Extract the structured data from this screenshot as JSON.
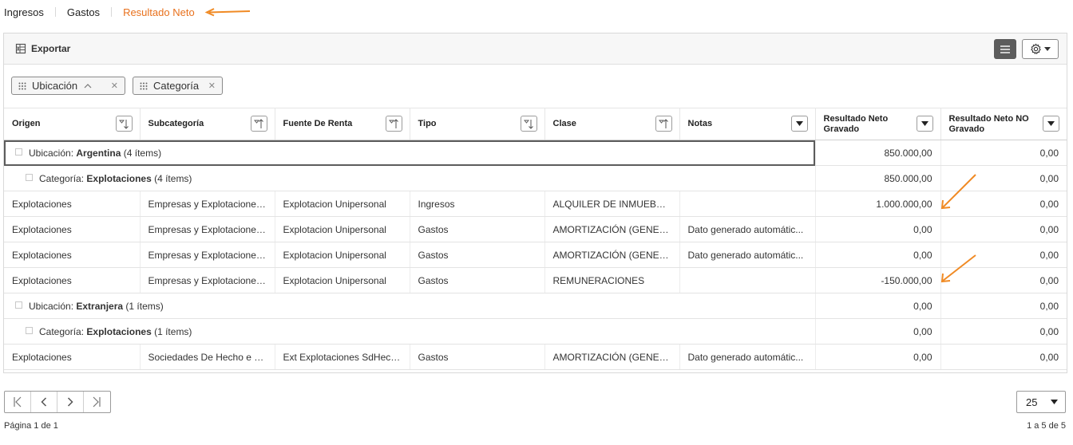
{
  "tabs": [
    {
      "label": "Ingresos",
      "active": false
    },
    {
      "label": "Gastos",
      "active": false
    },
    {
      "label": "Resultado Neto",
      "active": true
    }
  ],
  "toolbar": {
    "export_label": "Exportar"
  },
  "group_chips": [
    {
      "label": "Ubicación"
    },
    {
      "label": "Categoría"
    }
  ],
  "columns": [
    "Origen",
    "Subcategoría",
    "Fuente De Renta",
    "Tipo",
    "Clase",
    "Notas",
    "Resultado Neto Gravado",
    "Resultado Neto NO Gravado"
  ],
  "groups": {
    "g1": {
      "prefix": "Ubicación:",
      "name": "Argentina",
      "count": "(4 ítems)",
      "gravado": "850.000,00",
      "no_gravado": "0,00"
    },
    "g1c": {
      "prefix": "Categoría:",
      "name": "Explotaciones",
      "count": "(4 ítems)",
      "gravado": "850.000,00",
      "no_gravado": "0,00"
    },
    "g2": {
      "prefix": "Ubicación:",
      "name": "Extranjera",
      "count": "(1 ítems)",
      "gravado": "0,00",
      "no_gravado": "0,00"
    },
    "g2c": {
      "prefix": "Categoría:",
      "name": "Explotaciones",
      "count": "(1 ítems)",
      "gravado": "0,00",
      "no_gravado": "0,00"
    }
  },
  "rows": [
    {
      "origen": "Explotaciones",
      "subcategoria": "Empresas y Explotaciones...",
      "fuente": "Explotacion Unipersonal",
      "tipo": "Ingresos",
      "clase": "ALQUILER DE INMUEBLES",
      "notas": "",
      "gravado": "1.000.000,00",
      "no_gravado": "0,00"
    },
    {
      "origen": "Explotaciones",
      "subcategoria": "Empresas y Explotaciones...",
      "fuente": "Explotacion Unipersonal",
      "tipo": "Gastos",
      "clase": "AMORTIZACIÓN (GENER...",
      "notas": "Dato generado automátic...",
      "gravado": "0,00",
      "no_gravado": "0,00"
    },
    {
      "origen": "Explotaciones",
      "subcategoria": "Empresas y Explotaciones...",
      "fuente": "Explotacion Unipersonal",
      "tipo": "Gastos",
      "clase": "AMORTIZACIÓN (GENER...",
      "notas": "Dato generado automátic...",
      "gravado": "0,00",
      "no_gravado": "0,00"
    },
    {
      "origen": "Explotaciones",
      "subcategoria": "Empresas y Explotaciones...",
      "fuente": "Explotacion Unipersonal",
      "tipo": "Gastos",
      "clase": "REMUNERACIONES",
      "notas": "",
      "gravado": "-150.000,00",
      "no_gravado": "0,00"
    },
    {
      "origen": "Explotaciones",
      "subcategoria": "Sociedades De Hecho e Ir...",
      "fuente": "Ext Explotaciones SdHecho",
      "tipo": "Gastos",
      "clase": "AMORTIZACIÓN (GENER...",
      "notas": "Dato generado automátic...",
      "gravado": "0,00",
      "no_gravado": "0,00"
    }
  ],
  "pagination": {
    "page_size": "25",
    "page_info": "Página 1 de 1",
    "range_info": "1 a 5 de 5"
  },
  "colors": {
    "accent": "#e8711d",
    "annotation_arrow": "#f08a24"
  }
}
